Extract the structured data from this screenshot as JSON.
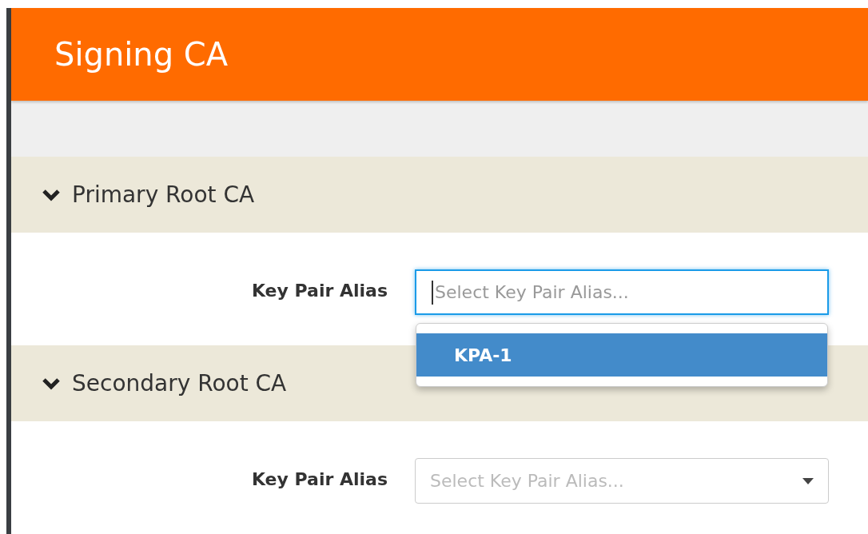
{
  "header": {
    "title": "Signing CA"
  },
  "sections": [
    {
      "title": "Primary Root CA",
      "expanded": true,
      "field": {
        "label": "Key Pair Alias",
        "placeholder": "Select Key Pair Alias...",
        "focused": true,
        "options": [
          {
            "label": "KPA-1",
            "selected": true
          }
        ]
      }
    },
    {
      "title": "Secondary Root CA",
      "expanded": true,
      "field": {
        "label": "Key Pair Alias",
        "placeholder": "Select Key Pair Alias...",
        "focused": false
      }
    }
  ]
}
